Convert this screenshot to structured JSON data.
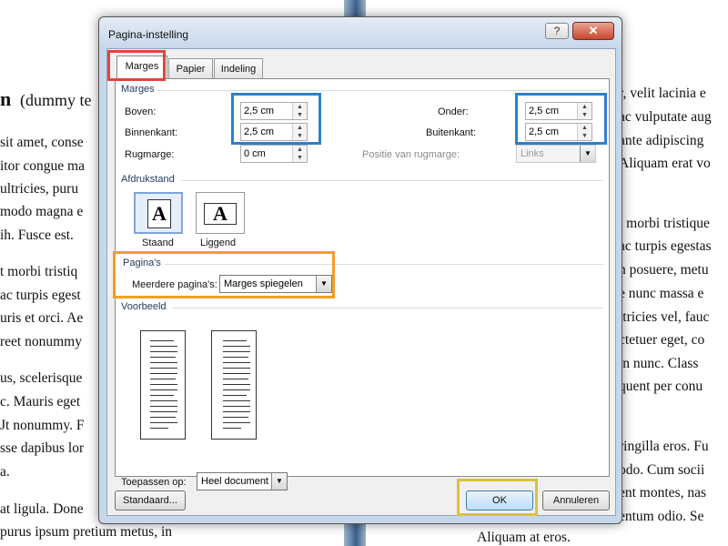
{
  "colors": {
    "highlight_red": "#e0453a",
    "highlight_blue": "#2f80c8",
    "highlight_orange": "#f0a022",
    "highlight_yellow": "#d8c43a"
  },
  "background_doc": {
    "left_lines": [
      "n",
      "(dummy te",
      "sit amet, conse",
      "itor congue ma",
      "ultricies, puru",
      "modo magna e",
      "ih. Fusce est.",
      "t morbi tristiq",
      "ac turpis egest",
      "uris et orci. Ae",
      "reet nonummy",
      "us, scelerisque",
      "c. Mauris eget",
      "Jt nonummy. F",
      "sse dapibus lor",
      "a.",
      "at ligula. Done",
      "purus ipsum pretium metus, in"
    ],
    "right_lines": [
      "r, velit lacinia e",
      "ac vulputate aug",
      "ante adipiscing",
      "Aliquam erat vo",
      "t morbi tristique",
      "ac turpis egestas",
      "n posuere, metu",
      "e nunc massa e",
      "ltricies vel, fauc",
      "ctetuer eget, co",
      "in nunc. Class",
      "quent per conu",
      "ringilla eros. Fu",
      "odo. Cum socii",
      "ent montes, nas",
      "entum odio. Se",
      "Aliquam at eros."
    ]
  },
  "dialog": {
    "title": "Pagina-instelling",
    "help_label": "?",
    "close_label": "✕",
    "tabs": [
      {
        "label": "Marges"
      },
      {
        "label": "Papier"
      },
      {
        "label": "Indeling"
      }
    ],
    "margins_group": "Marges",
    "top_label": "Boven:",
    "top_value": "2,5 cm",
    "inside_label": "Binnenkant:",
    "inside_value": "2,5 cm",
    "gutter_label": "Rugmarge:",
    "gutter_value": "0 cm",
    "bottom_label": "Onder:",
    "bottom_value": "2,5 cm",
    "outside_label": "Buitenkant:",
    "outside_value": "2,5 cm",
    "gutter_pos_label": "Positie van rugmarge:",
    "gutter_pos_value": "Links",
    "orientation_group": "Afdrukstand",
    "portrait_label": "Staand",
    "landscape_label": "Liggend",
    "orientation_glyph": "A",
    "pages_group": "Pagina's",
    "multiple_pages_label": "Meerdere pagina's:",
    "multiple_pages_value": "Marges spiegelen",
    "preview_group": "Voorbeeld",
    "apply_to_label": "Toepassen op:",
    "apply_to_value": "Heel document",
    "default_button": "Standaard...",
    "ok_button": "OK",
    "cancel_button": "Annuleren"
  }
}
